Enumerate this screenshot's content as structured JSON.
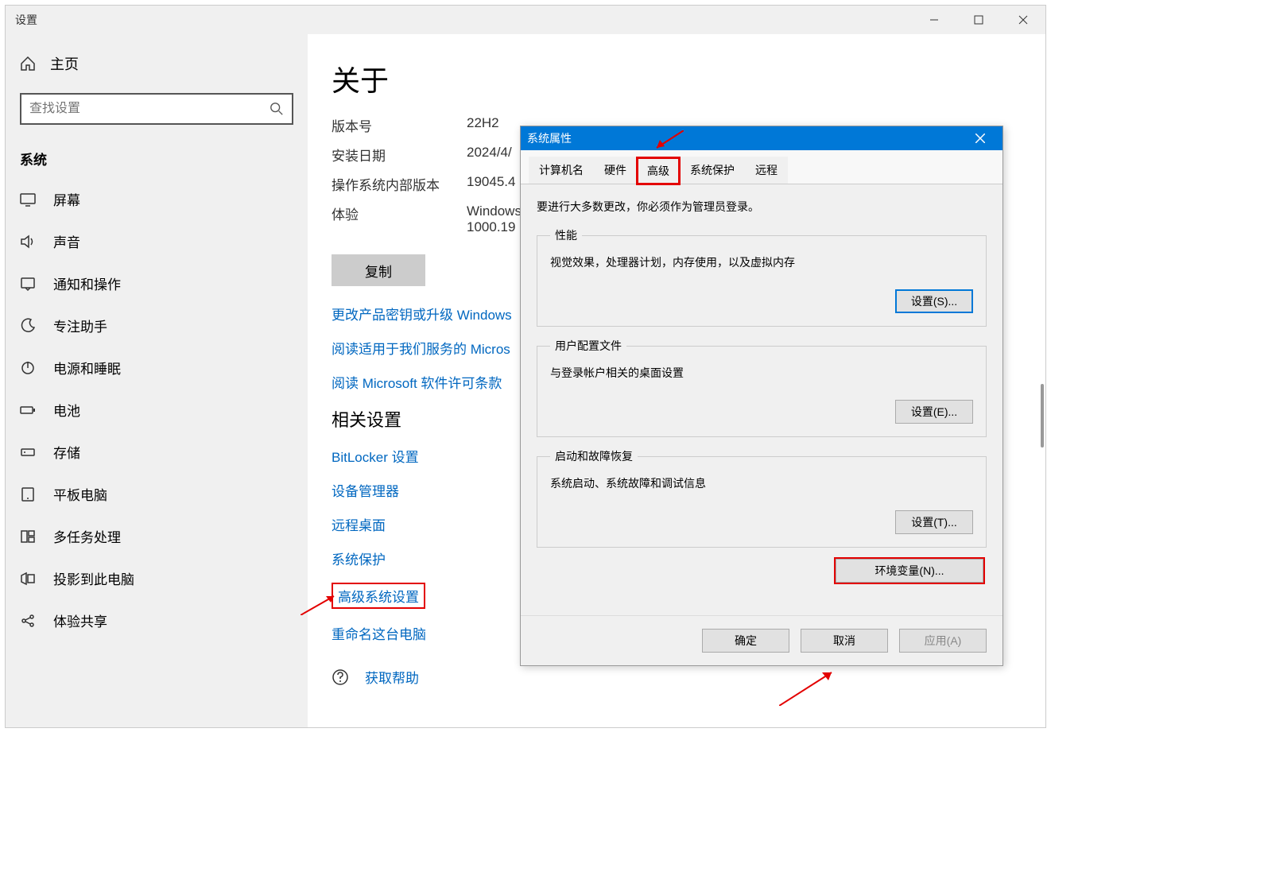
{
  "settings": {
    "window_title": "设置",
    "home": "主页",
    "search_placeholder": "查找设置",
    "sidebar_header": "系统",
    "items": [
      {
        "label": "屏幕"
      },
      {
        "label": "声音"
      },
      {
        "label": "通知和操作"
      },
      {
        "label": "专注助手"
      },
      {
        "label": "电源和睡眠"
      },
      {
        "label": "电池"
      },
      {
        "label": "存储"
      },
      {
        "label": "平板电脑"
      },
      {
        "label": "多任务处理"
      },
      {
        "label": "投影到此电脑"
      },
      {
        "label": "体验共享"
      }
    ]
  },
  "content": {
    "title": "关于",
    "rows": [
      {
        "label": "版本号",
        "value": "22H2"
      },
      {
        "label": "安装日期",
        "value": "2024/4/"
      },
      {
        "label": "操作系统内部版本",
        "value": "19045.4"
      },
      {
        "label": "体验",
        "value": "Windows\n1000.19"
      }
    ],
    "copy_label": "复制",
    "links1": [
      "更改产品密钥或升级 Windows",
      "阅读适用于我们服务的 Micros",
      "阅读 Microsoft 软件许可条款"
    ],
    "related_title": "相关设置",
    "links2": [
      "BitLocker 设置",
      "设备管理器",
      "远程桌面",
      "系统保护",
      "高级系统设置",
      "重命名这台电脑"
    ],
    "help_label": "获取帮助"
  },
  "dialog": {
    "title": "系统属性",
    "tabs": [
      "计算机名",
      "硬件",
      "高级",
      "系统保护",
      "远程"
    ],
    "active_tab": "高级",
    "note": "要进行大多数更改，你必须作为管理员登录。",
    "fieldsets": [
      {
        "legend": "性能",
        "desc": "视觉效果，处理器计划，内存使用，以及虚拟内存",
        "btn": "设置(S)..."
      },
      {
        "legend": "用户配置文件",
        "desc": "与登录帐户相关的桌面设置",
        "btn": "设置(E)..."
      },
      {
        "legend": "启动和故障恢复",
        "desc": "系统启动、系统故障和调试信息",
        "btn": "设置(T)..."
      }
    ],
    "env_btn": "环境变量(N)...",
    "footer": {
      "ok": "确定",
      "cancel": "取消",
      "apply": "应用(A)"
    }
  }
}
